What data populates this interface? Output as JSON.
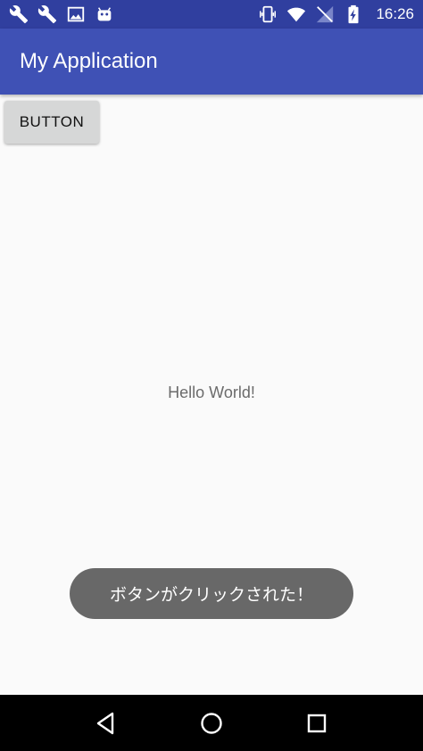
{
  "status_bar": {
    "left_icons": [
      "wrench-icon",
      "wrench-icon",
      "image-icon",
      "android-icon"
    ],
    "right_icons": [
      "vibrate-icon",
      "wifi-icon",
      "no-sim-icon",
      "battery-charging-icon"
    ],
    "time": "16:26",
    "bg_color": "#303f9f"
  },
  "app_bar": {
    "title": "My Application",
    "bg_color": "#3f51b5"
  },
  "main": {
    "button_label": "BUTTON",
    "hello_text": "Hello World!"
  },
  "toast": {
    "message": "ボタンがクリックされた！"
  },
  "nav_bar": {
    "buttons": [
      "back-icon",
      "home-icon",
      "recents-icon"
    ]
  }
}
